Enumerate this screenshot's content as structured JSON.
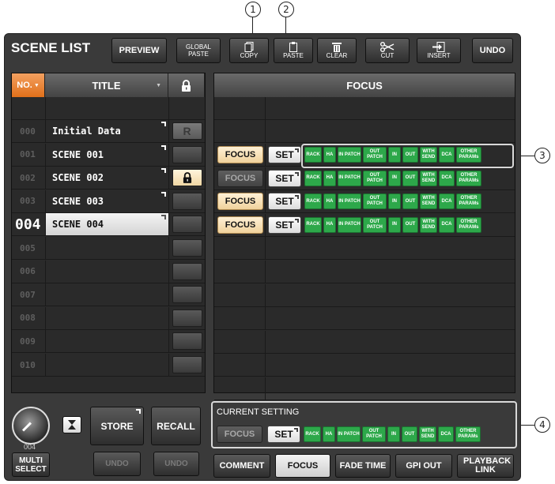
{
  "title": "SCENE LIST",
  "toolbar": {
    "preview": "PREVIEW",
    "global_paste_top": "GLOBAL",
    "global_paste_bottom": "PASTE",
    "copy": "COPY",
    "paste": "PASTE",
    "clear": "CLEAR",
    "cut": "CUT",
    "insert": "INSERT",
    "undo": "UNDO"
  },
  "callouts": [
    "1",
    "2",
    "3",
    "4"
  ],
  "left_table": {
    "col_no": "NO.",
    "col_title": "TITLE",
    "rows": [
      {
        "no": "000",
        "title": "Initial Data",
        "protect": "R"
      },
      {
        "no": "001",
        "title": "SCENE 001",
        "protect": ""
      },
      {
        "no": "002",
        "title": "SCENE 002",
        "protect": "lock"
      },
      {
        "no": "003",
        "title": "SCENE 003",
        "protect": ""
      },
      {
        "no": "004",
        "title": "SCENE 004",
        "protect": ""
      },
      {
        "no": "005",
        "title": "",
        "protect": ""
      },
      {
        "no": "006",
        "title": "",
        "protect": ""
      },
      {
        "no": "007",
        "title": "",
        "protect": ""
      },
      {
        "no": "008",
        "title": "",
        "protect": ""
      },
      {
        "no": "009",
        "title": "",
        "protect": ""
      },
      {
        "no": "010",
        "title": "",
        "protect": ""
      }
    ],
    "selected_no": "004"
  },
  "right_table": {
    "header": "FOCUS",
    "focus_label": "FOCUS",
    "set_label": "SET",
    "tags": [
      "RACK",
      "HA",
      "IN PATCH",
      "OUT PATCH",
      "IN",
      "OUT",
      "WITH SEND",
      "DCA",
      "OTHER PARAMs"
    ],
    "rows": [
      {
        "focus_on": true
      },
      {
        "focus_on": false
      },
      {
        "focus_on": true
      },
      {
        "focus_on": true
      }
    ]
  },
  "current_setting": {
    "label": "CURRENT SETTING",
    "focus": "FOCUS",
    "set": "SET"
  },
  "bottom": {
    "knob_value": "004",
    "multi_select": "MULTI SELECT",
    "store": "STORE",
    "recall": "RECALL",
    "undo1": "UNDO",
    "undo2": "UNDO"
  },
  "tabs": [
    "COMMENT",
    "FOCUS",
    "FADE TIME",
    "GPI OUT",
    "PLAYBACK LINK"
  ],
  "selected_tab": "FOCUS"
}
